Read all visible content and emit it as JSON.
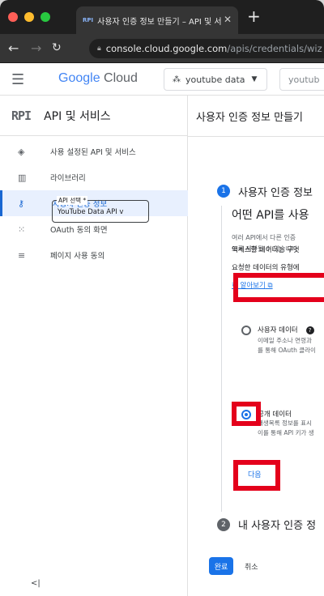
{
  "browser": {
    "tab_title": "사용자 인증 정보 만들기 – API 및 서",
    "tab_favicon": "RPI",
    "new_tab": "+",
    "url_host": "console.cloud.google.com",
    "url_path": "/apis/credentials/wiz"
  },
  "header": {
    "logo_google": "Google",
    "logo_cloud": " Cloud",
    "project_name": "youtube data",
    "search_text": "youtub"
  },
  "sidebar": {
    "api_mark": "RPI",
    "title": "API 및 서비스",
    "items": [
      {
        "label": "사용 설정된 API 및 서비스",
        "icon": "enabled-apis-icon"
      },
      {
        "label": "라이브러리",
        "icon": "library-icon"
      },
      {
        "label": "사용자 인증 정보",
        "icon": "key-icon"
      },
      {
        "label": "OAuth 동의 화면",
        "icon": "oauth-consent-icon"
      },
      {
        "label": "페이지 사용 동의",
        "icon": "page-consent-icon"
      }
    ],
    "collapse": "<|"
  },
  "main": {
    "page_title": "사용자 인증 정보 만들기",
    "step1_number": "1",
    "step1_title": "사용자 인증 정보",
    "question_title": "어떤 API를 사용",
    "desc_line1": "여러 API에서 다른 인증",
    "desc_line2": "도록 제한될 수 있습니다",
    "api_field_label": "API 선택 *",
    "api_field_value": "YouTube Data API v",
    "data_question": "액세스할 데이터는 무엇",
    "data_desc": "요청한 데이터의 유형에",
    "learn_more": "히 알아보기",
    "radio_user_label": "사용자 데이터",
    "radio_user_desc1": "이메일 주소나 연령과",
    "radio_user_desc2": "를 통해 OAuth 클라이",
    "radio_public_label": "공개 데이터",
    "radio_public_desc1": "재생목록 정보를 표시",
    "radio_public_desc2": "이를 통해 API 키가 생",
    "next_button": "다음",
    "step2_number": "2",
    "step2_title": "내 사용자 인증 정",
    "done_button": "완료",
    "cancel_button": "취소"
  },
  "colors": {
    "accent": "#1a73e8",
    "highlight": "#e4001b",
    "active_bg": "#e8f0fe"
  }
}
